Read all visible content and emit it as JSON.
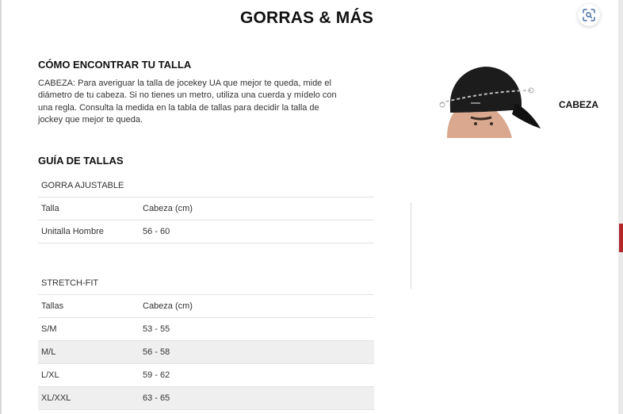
{
  "title": "GORRAS & MÁS",
  "how_to": {
    "heading": "CÓMO ENCONTRAR TU TALLA",
    "text": "CABEZA: Para averiguar la talla de jocekey UA que mejor te queda, mide el diámetro de tu cabeza. Si no tienes un metro, utiliza una cuerda y mídelo con una regla. Consulta la medida en la tabla de tallas para decidir la talla de jockey que mejor te queda."
  },
  "figure": {
    "label": "CABEZA"
  },
  "guide": {
    "heading": "GUÍA DE TALLAS",
    "adjustable": {
      "caption": "GORRA AJUSTABLE",
      "header": [
        "Talla",
        "Cabeza (cm)"
      ],
      "rows": [
        [
          "Unitalla Hombre",
          "56 - 60"
        ]
      ]
    },
    "stretch_fit": {
      "caption": "STRETCH-FIT",
      "header": [
        "Tallas",
        "Cabeza (cm)"
      ],
      "rows": [
        [
          "S/M",
          "53 - 55"
        ],
        [
          "M/L",
          "56 - 58"
        ],
        [
          "L/XL",
          "59 - 62"
        ],
        [
          "XL/XXL",
          "63 - 65"
        ]
      ]
    }
  },
  "icons": {
    "lens": "image-search-icon"
  },
  "colors": {
    "accent_red": "#b3262b",
    "alt_row": "#efefef"
  }
}
